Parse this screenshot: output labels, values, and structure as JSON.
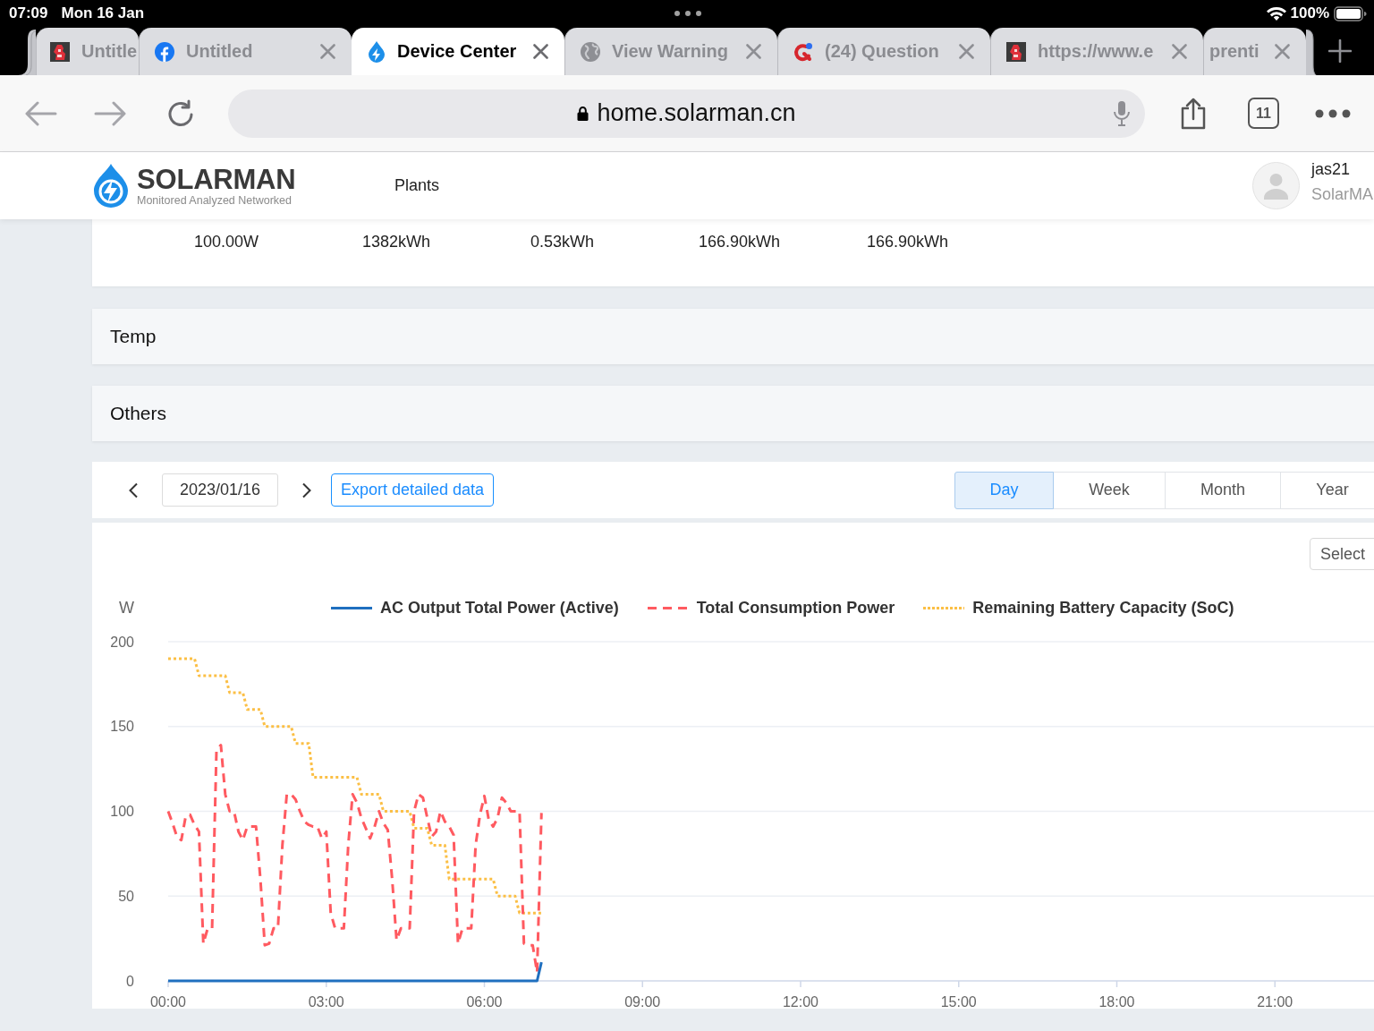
{
  "status_bar": {
    "time": "07:09",
    "date": "Mon 16 Jan",
    "battery": "100%"
  },
  "browser_tabs": [
    {
      "title": "Untitle",
      "kind": "picture",
      "selected": false,
      "closable": false,
      "stacked": true
    },
    {
      "title": "Untitled",
      "kind": "letter_f",
      "selected": false,
      "closable": true,
      "stacked": false
    },
    {
      "title": "Device Center",
      "kind": "drop",
      "selected": true,
      "closable": true,
      "stacked": false
    },
    {
      "title": "View Warning",
      "kind": "globe",
      "selected": false,
      "closable": true,
      "stacked": false
    },
    {
      "title": "(24) Question",
      "kind": "ring_dot",
      "selected": false,
      "closable": true,
      "stacked": false
    },
    {
      "title": "https://www.e",
      "kind": "picture",
      "selected": false,
      "closable": true,
      "stacked": false
    },
    {
      "title": "prenti",
      "kind": "none",
      "selected": false,
      "closable": true,
      "stacked": true
    }
  ],
  "address_bar": {
    "url": "home.solarman.cn",
    "tab_count": "11"
  },
  "site_header": {
    "brand": "SOLARMAN",
    "tagline": "Monitored Analyzed Networked",
    "nav": [
      {
        "label": "Plants"
      }
    ],
    "user": {
      "name": "jas21",
      "org": "SolarMA"
    }
  },
  "stats": [
    "100.00W",
    "1382kWh",
    "0.53kWh",
    "166.90kWh",
    "166.90kWh"
  ],
  "sections": [
    {
      "title": "Temp"
    },
    {
      "title": "Others"
    }
  ],
  "toolbar": {
    "date": "2023/01/16",
    "export_label": "Export detailed data",
    "periods": [
      {
        "label": "Day",
        "selected": true
      },
      {
        "label": "Week",
        "selected": false
      },
      {
        "label": "Month",
        "selected": false
      },
      {
        "label": "Year",
        "selected": false
      }
    ]
  },
  "chart": {
    "select_label": "Select",
    "chart_data": {
      "type": "line",
      "ylabel": "W",
      "grid": true,
      "xlim": [
        0,
        1440
      ],
      "ylim": [
        0,
        200
      ],
      "yticks": [
        0,
        50,
        100,
        150,
        200
      ],
      "xticks": [
        {
          "value": 0,
          "label": "00:00"
        },
        {
          "value": 180,
          "label": "03:00"
        },
        {
          "value": 360,
          "label": "06:00"
        },
        {
          "value": 540,
          "label": "09:00"
        },
        {
          "value": 720,
          "label": "12:00"
        },
        {
          "value": 900,
          "label": "15:00"
        },
        {
          "value": 1080,
          "label": "18:00"
        },
        {
          "value": 1260,
          "label": "21:00"
        }
      ],
      "x": [
        0,
        5,
        10,
        15,
        20,
        25,
        30,
        35,
        40,
        45,
        50,
        55,
        60,
        65,
        70,
        75,
        80,
        85,
        90,
        95,
        100,
        105,
        110,
        115,
        120,
        125,
        130,
        135,
        140,
        145,
        150,
        155,
        160,
        165,
        170,
        175,
        180,
        185,
        190,
        195,
        200,
        205,
        210,
        215,
        220,
        225,
        230,
        235,
        240,
        245,
        250,
        255,
        260,
        265,
        270,
        275,
        280,
        285,
        290,
        295,
        300,
        305,
        310,
        315,
        320,
        325,
        330,
        335,
        340,
        345,
        350,
        355,
        360,
        365,
        370,
        375,
        380,
        385,
        390,
        395,
        400,
        405,
        410,
        415,
        420,
        425
      ],
      "series": [
        {
          "name": "AC Output Total Power (Active)",
          "color": "#1f6fbf",
          "line_style": "solid",
          "values": [
            0,
            0,
            0,
            0,
            0,
            0,
            0,
            0,
            0,
            0,
            0,
            0,
            0,
            0,
            0,
            0,
            0,
            0,
            0,
            0,
            0,
            0,
            0,
            0,
            0,
            0,
            0,
            0,
            0,
            0,
            0,
            0,
            0,
            0,
            0,
            0,
            0,
            0,
            0,
            0,
            0,
            0,
            0,
            0,
            0,
            0,
            0,
            0,
            0,
            0,
            0,
            0,
            0,
            0,
            0,
            0,
            0,
            0,
            0,
            0,
            0,
            0,
            0,
            0,
            0,
            0,
            0,
            0,
            0,
            0,
            0,
            0,
            0,
            0,
            0,
            0,
            0,
            0,
            0,
            0,
            0,
            0,
            0,
            0,
            0,
            11
          ]
        },
        {
          "name": "Total Consumption Power",
          "color": "#ff5a60",
          "line_style": "dashed",
          "values": [
            100,
            93,
            85,
            83,
            97,
            98,
            92,
            88,
            22,
            31,
            31,
            136,
            139,
            110,
            100,
            100,
            88,
            83,
            91,
            91,
            91,
            60,
            21,
            22,
            31,
            31,
            80,
            110,
            110,
            107,
            100,
            94,
            92,
            91,
            91,
            84,
            88,
            40,
            31,
            31,
            31,
            80,
            110,
            105,
            96,
            90,
            84,
            91,
            100,
            93,
            89,
            60,
            24,
            31,
            31,
            31,
            100,
            110,
            108,
            96,
            85,
            88,
            100,
            94,
            91,
            86,
            22,
            31,
            31,
            31,
            80,
            98,
            109,
            95,
            91,
            96,
            108,
            105,
            100,
            100,
            100,
            22,
            21,
            21,
            5,
            99
          ]
        },
        {
          "name": "Remaining Battery Capacity (SoC)",
          "color": "#fbbf45",
          "line_style": "dotted",
          "values": [
            190,
            190,
            190,
            190,
            190,
            190,
            190,
            180,
            180,
            180,
            180,
            180,
            180,
            180,
            170,
            170,
            170,
            170,
            160,
            160,
            160,
            160,
            150,
            150,
            150,
            150,
            150,
            150,
            150,
            140,
            140,
            140,
            140,
            120,
            120,
            120,
            120,
            120,
            120,
            120,
            120,
            120,
            120,
            120,
            110,
            110,
            110,
            110,
            110,
            100,
            100,
            100,
            100,
            100,
            100,
            100,
            90,
            90,
            90,
            90,
            80,
            80,
            80,
            80,
            60,
            60,
            60,
            60,
            60,
            60,
            60,
            60,
            60,
            60,
            60,
            50,
            50,
            50,
            50,
            50,
            40,
            40,
            40,
            40,
            40,
            40
          ]
        }
      ]
    }
  }
}
